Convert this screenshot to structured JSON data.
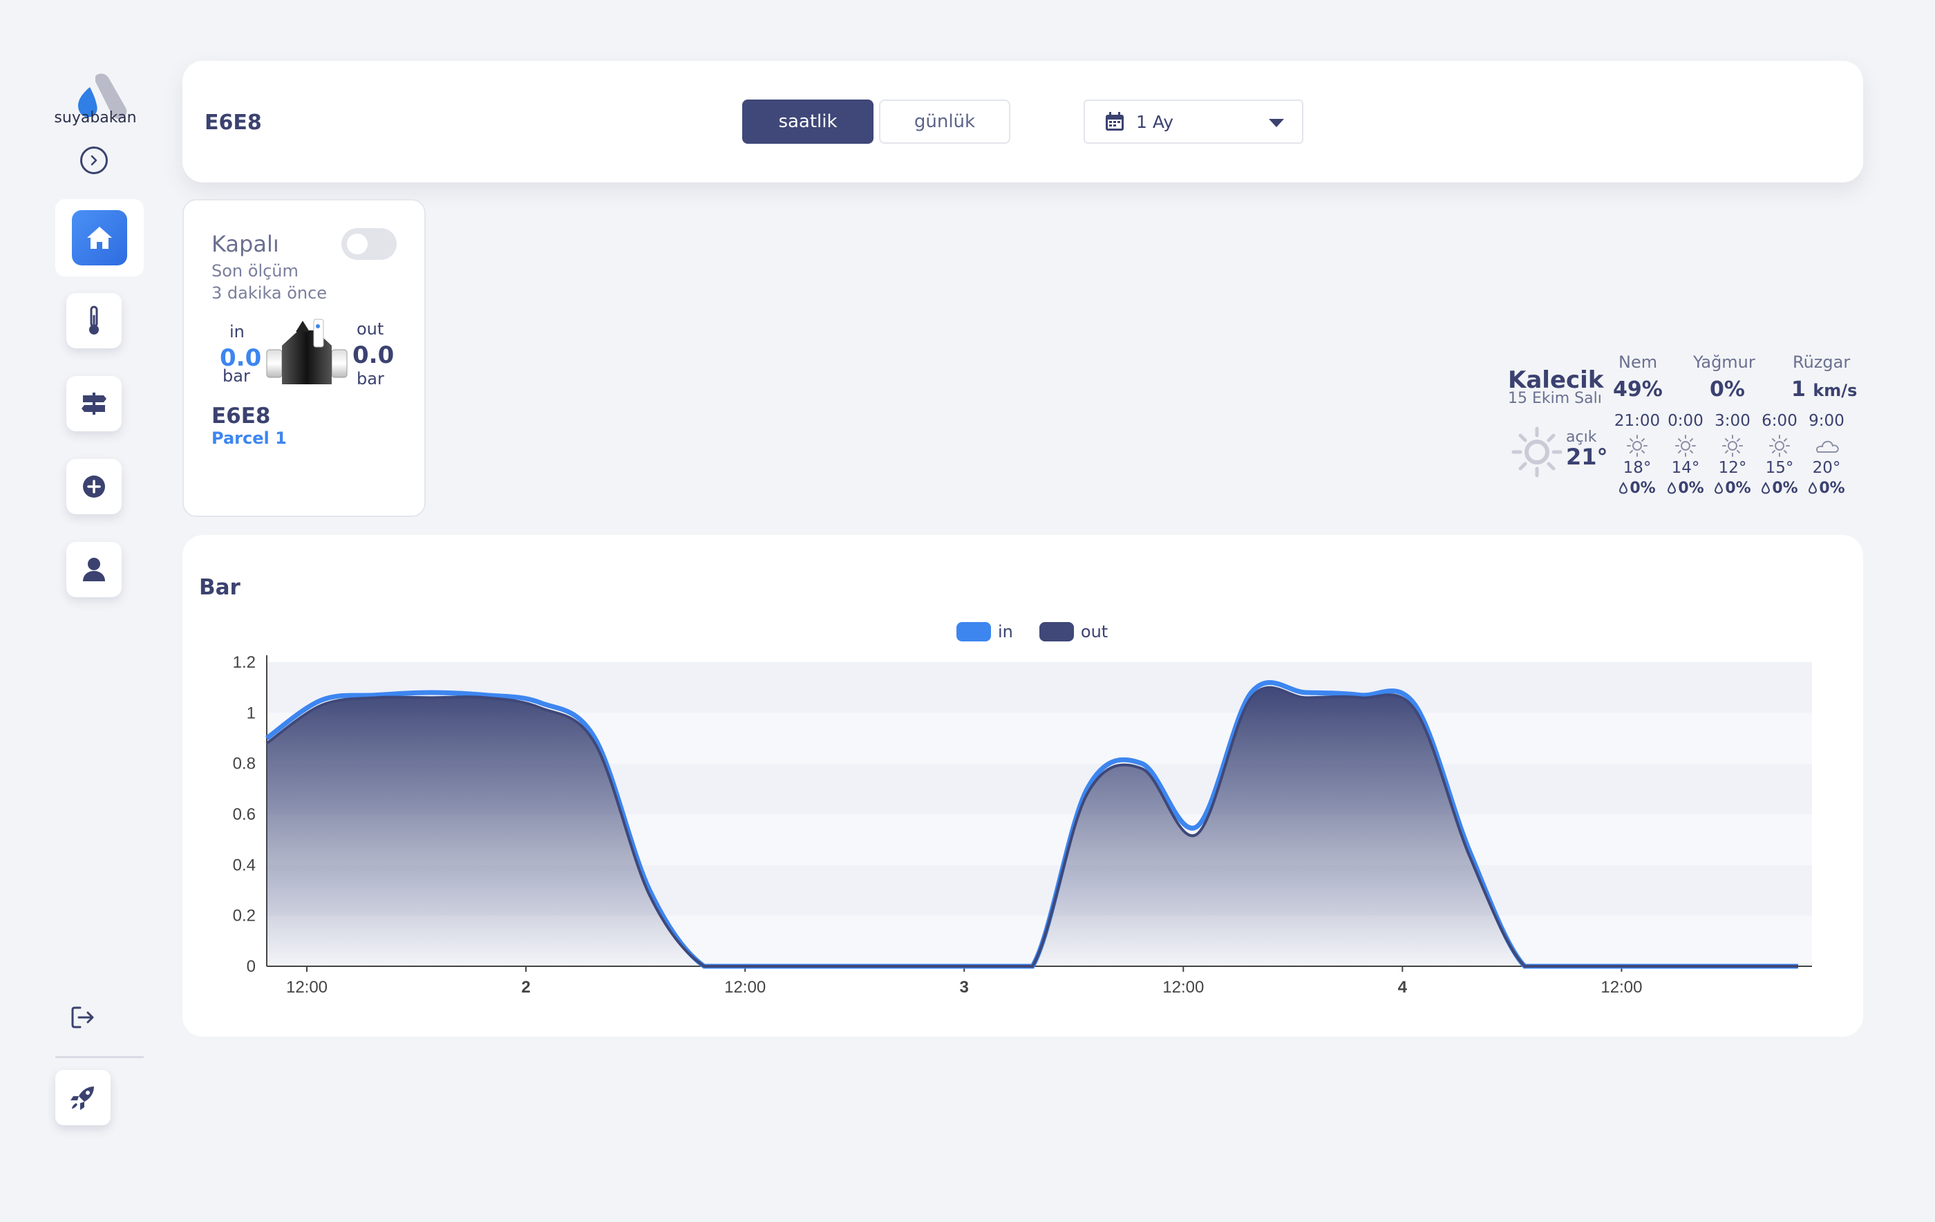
{
  "brand": {
    "name": "suyabakan"
  },
  "sidebar": {
    "items": [
      {
        "icon": "home-icon",
        "active": true
      },
      {
        "icon": "thermometer-icon",
        "active": false
      },
      {
        "icon": "signpost-icon",
        "active": false
      },
      {
        "icon": "plus-circle-icon",
        "active": false
      },
      {
        "icon": "user-icon",
        "active": false
      }
    ],
    "logout_icon": "logout-icon",
    "rocket_icon": "rocket-icon"
  },
  "header": {
    "device": "E6E8",
    "tab_hourly": "saatlik",
    "tab_daily": "günlük",
    "range": "1 Ay"
  },
  "device_card": {
    "status": "Kapalı",
    "last_measure_label": "Son ölçüm",
    "last_measure_ago": "3 dakika önce",
    "in_label": "in",
    "in_value": "0.0",
    "in_unit": "bar",
    "out_label": "out",
    "out_value": "0.0",
    "out_unit": "bar",
    "name": "E6E8",
    "parcel": "Parcel 1"
  },
  "weather": {
    "city": "Kalecik",
    "date": "15 Ekim Salı",
    "condition": "açık",
    "temp": "21°",
    "humidity_label": "Nem",
    "humidity": "49%",
    "rain_label": "Yağmur",
    "rain": "0%",
    "wind_label": "Rüzgar",
    "wind": "1",
    "wind_unit": "km/s",
    "forecast": [
      {
        "time": "21:00",
        "icon": "sun-icon",
        "temp": "18°",
        "rain": "0%"
      },
      {
        "time": "0:00",
        "icon": "sun-icon",
        "temp": "14°",
        "rain": "0%"
      },
      {
        "time": "3:00",
        "icon": "sun-icon",
        "temp": "12°",
        "rain": "0%"
      },
      {
        "time": "6:00",
        "icon": "sun-icon",
        "temp": "15°",
        "rain": "0%"
      },
      {
        "time": "9:00",
        "icon": "cloud-icon",
        "temp": "20°",
        "rain": "0%"
      }
    ]
  },
  "colors": {
    "in": "#3d86f0",
    "out": "#3f4878",
    "accent": "#3d86f0"
  },
  "chart_data": {
    "type": "area",
    "title": "Bar",
    "ylim": [
      0,
      1.2
    ],
    "yticks": [
      "0",
      "0.2",
      "0.4",
      "0.6",
      "0.8",
      "1",
      "1.2"
    ],
    "xticks": [
      "12:00",
      "2",
      "12:00",
      "3",
      "12:00",
      "4",
      "12:00"
    ],
    "x_hours": [
      0,
      3,
      6,
      9,
      12,
      15,
      18,
      21,
      24,
      27,
      30,
      33,
      36,
      39,
      42,
      45,
      48,
      51,
      54,
      57,
      60,
      63,
      66,
      69,
      72,
      75,
      78,
      81,
      84
    ],
    "series": [
      {
        "name": "in",
        "color": "#3d86f0",
        "values": [
          0.9,
          1.05,
          1.07,
          1.08,
          1.07,
          1.04,
          0.9,
          0.3,
          0,
          0,
          0,
          0,
          0,
          0,
          0,
          0.7,
          0.8,
          0.55,
          1.08,
          1.08,
          1.07,
          1.03,
          0.45,
          0,
          0,
          0,
          0,
          0,
          0
        ]
      },
      {
        "name": "out",
        "color": "#3f4878",
        "values": [
          0.88,
          1.03,
          1.06,
          1.06,
          1.06,
          1.02,
          0.88,
          0.28,
          0,
          0,
          0,
          0,
          0,
          0,
          0,
          0.68,
          0.78,
          0.52,
          1.06,
          1.06,
          1.06,
          1.01,
          0.43,
          0,
          0,
          0,
          0,
          0,
          0
        ]
      }
    ],
    "grid": true,
    "legend": "top-center"
  }
}
